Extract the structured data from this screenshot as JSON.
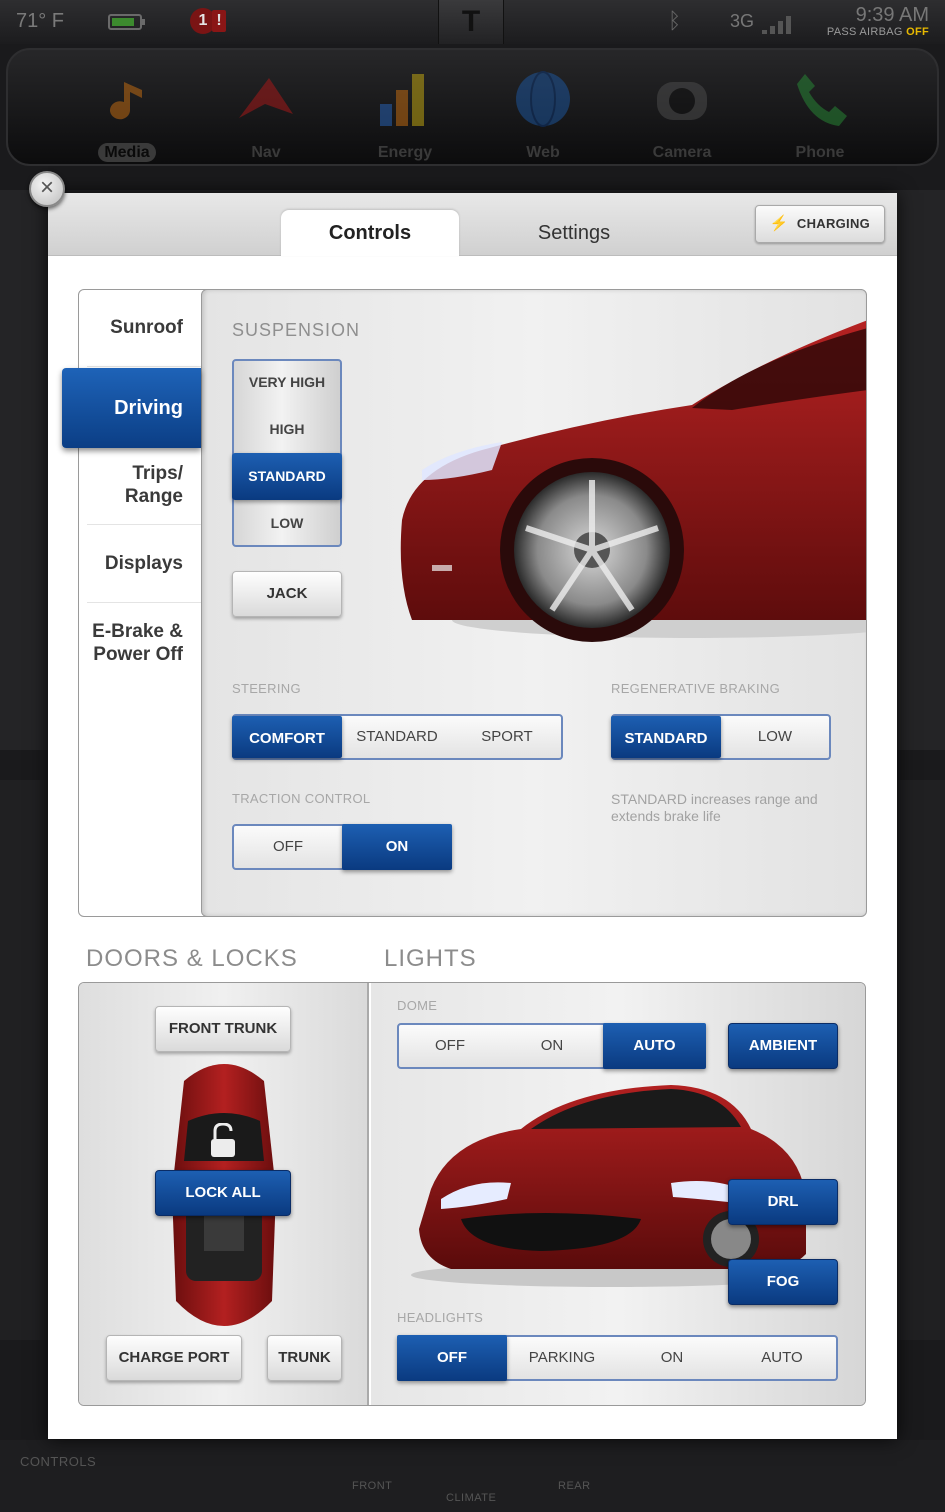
{
  "status": {
    "temperature": "71° F",
    "alert_count": "1",
    "alert_mark": "!",
    "network": "3G",
    "time": "9:39 AM",
    "airbag_label": "PASS AIRBAG",
    "airbag_state": "OFF",
    "battery_level": 0.8,
    "logo": "T"
  },
  "dock": {
    "items": [
      {
        "label": "Media",
        "icon": "music-note-icon",
        "active": true
      },
      {
        "label": "Nav",
        "icon": "navigation-arrow-icon"
      },
      {
        "label": "Energy",
        "icon": "energy-bars-icon"
      },
      {
        "label": "Web",
        "icon": "globe-icon"
      },
      {
        "label": "Camera",
        "icon": "camera-icon"
      },
      {
        "label": "Phone",
        "icon": "phone-icon"
      }
    ]
  },
  "bottom_bar": {
    "controls": "CONTROLS",
    "front": "FRONT",
    "climate": "CLIMATE",
    "rear": "REAR"
  },
  "modal": {
    "close_glyph": "×",
    "tabs": [
      {
        "label": "Controls",
        "active": true
      },
      {
        "label": "Settings",
        "active": false
      }
    ],
    "charging_label": "CHARGING",
    "charging_icon": "⚡",
    "side_nav": [
      {
        "label": "Sunroof"
      },
      {
        "label": "Driving",
        "active": true
      },
      {
        "label": "Trips/ Range"
      },
      {
        "label": "Displays"
      },
      {
        "label": "E-Brake & Power Off"
      }
    ],
    "driving": {
      "suspension_title": "SUSPENSION",
      "suspension_options": [
        "VERY HIGH",
        "HIGH",
        "STANDARD",
        "LOW"
      ],
      "suspension_selected": "STANDARD",
      "jack_label": "JACK",
      "steering_title": "STEERING",
      "steering_options": [
        "COMFORT",
        "STANDARD",
        "SPORT"
      ],
      "steering_selected": "COMFORT",
      "regen_title": "REGENERATIVE BRAKING",
      "regen_options": [
        "STANDARD",
        "LOW"
      ],
      "regen_selected": "STANDARD",
      "traction_title": "TRACTION CONTROL",
      "traction_options": [
        "OFF",
        "ON"
      ],
      "traction_selected": "ON",
      "regen_hint": "STANDARD increases range and extends brake life"
    },
    "doors": {
      "heading": "DOORS & LOCKS",
      "front_trunk": "FRONT TRUNK",
      "lock_all": "LOCK ALL",
      "charge_port": "CHARGE PORT",
      "trunk": "TRUNK"
    },
    "lights": {
      "heading": "LIGHTS",
      "dome_title": "DOME",
      "dome_options": [
        "OFF",
        "ON",
        "AUTO"
      ],
      "dome_selected": "AUTO",
      "ambient": "AMBIENT",
      "drl": "DRL",
      "fog": "FOG",
      "headlights_title": "HEADLIGHTS",
      "headlight_options": [
        "OFF",
        "PARKING",
        "ON",
        "AUTO"
      ],
      "headlights_selected": "OFF"
    }
  },
  "colors": {
    "accent_blue": "#0b3e85",
    "car_red": "#8b1515",
    "airbag_off": "#e8b900"
  }
}
